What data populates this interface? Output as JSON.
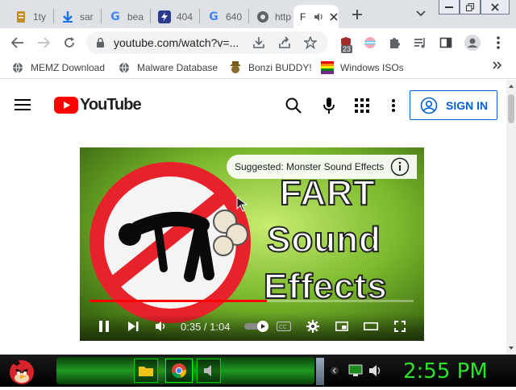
{
  "tabs": [
    {
      "title": "1ty",
      "icon": "document-icon",
      "color": "#c58a2a"
    },
    {
      "title": "sar",
      "icon": "download-icon",
      "color": "#1a73e8"
    },
    {
      "title": "bea",
      "icon": "google-icon",
      "color": "#4285f4"
    },
    {
      "title": "404",
      "icon": "lightning-icon",
      "color": "#2b3a8c"
    },
    {
      "title": "640",
      "icon": "google-icon",
      "color": "#4285f4"
    },
    {
      "title": "http",
      "icon": "globe-icon",
      "color": "#5f6368"
    },
    {
      "title": "F",
      "icon": "youtube-icon",
      "color": "#ff0000",
      "active": true
    }
  ],
  "browser": {
    "url": "youtube.com/watch?v=...",
    "extension_badge": "23"
  },
  "bookmarks": [
    {
      "label": "MEMZ Download",
      "icon": "globe-icon"
    },
    {
      "label": "Malware Database",
      "icon": "globe-icon"
    },
    {
      "label": "Bonzi BUDDY!",
      "icon": "bonzi-icon"
    },
    {
      "label": "Windows ISOs",
      "icon": "windows-icon"
    }
  ],
  "youtube": {
    "logo_text": "YouTube",
    "sign_in": "SIGN IN"
  },
  "video": {
    "suggested_label": "Suggested: Monster Sound Effects",
    "thumb_line1": "FART",
    "thumb_line2": "Sound",
    "thumb_line3": "Effects",
    "current_time": "0:35",
    "duration": "1:04",
    "time_display": "0:35 / 1:04",
    "progress": 0.547
  },
  "taskbar": {
    "clock": "2:55 PM",
    "accent": "#2fe02f"
  },
  "colors": {
    "tabstrip": "#dee1e6",
    "youtube_red": "#ff0000",
    "signin_blue": "#065fd4"
  }
}
